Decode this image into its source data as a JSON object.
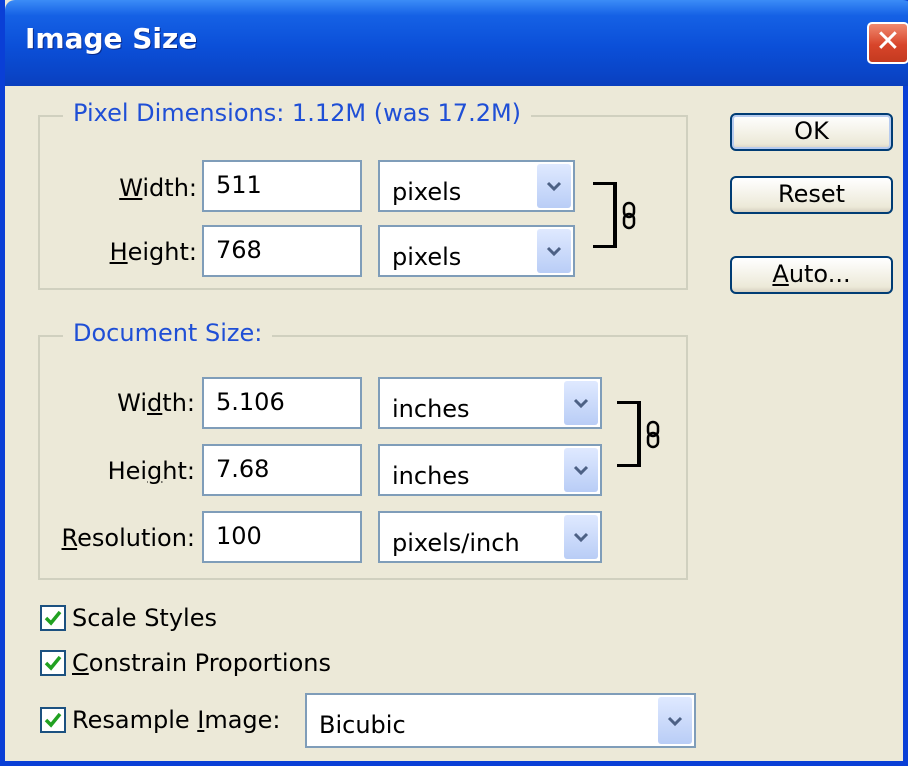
{
  "window": {
    "title": "Image Size",
    "close_glyph": "✕"
  },
  "pixel_dimensions": {
    "legend": "Pixel Dimensions:  1.12M (was 17.2M)",
    "width": {
      "label_pre": "",
      "label_key": "W",
      "label_post": "idth:",
      "value": "511",
      "unit": "pixels"
    },
    "height": {
      "label_pre": "",
      "label_key": "H",
      "label_post": "eight:",
      "value": "768",
      "unit": "pixels"
    }
  },
  "document_size": {
    "legend": "Document Size:",
    "width": {
      "label_pre": "Wi",
      "label_key": "d",
      "label_post": "th:",
      "value": "5.106",
      "unit": "inches"
    },
    "height": {
      "label_pre": "Hei",
      "label_key": "g",
      "label_post": "ht:",
      "value": "7.68",
      "unit": "inches"
    },
    "resolution": {
      "label_pre": "",
      "label_key": "R",
      "label_post": "esolution:",
      "value": "100",
      "unit": "pixels/inch"
    }
  },
  "options": {
    "scale_styles": {
      "label": "Scale Styles",
      "checked": true
    },
    "constrain": {
      "label_key": "C",
      "label_post": "onstrain Proportions",
      "checked": true
    },
    "resample": {
      "label_pre": "Resample ",
      "label_key": "I",
      "label_post": "mage:",
      "checked": true,
      "method": "Bicubic"
    }
  },
  "buttons": {
    "ok": "OK",
    "reset": "Reset",
    "auto_key": "A",
    "auto_post": "uto..."
  },
  "icons": {
    "dropdown": "chevron-down-icon",
    "link": "chain-link-icon",
    "check": "checkmark-icon"
  },
  "colors": {
    "title_bar": "#0a4fd8",
    "legend_text": "#1f4fd6",
    "dialog_bg": "#ece9d8",
    "close": "#d8452a"
  }
}
